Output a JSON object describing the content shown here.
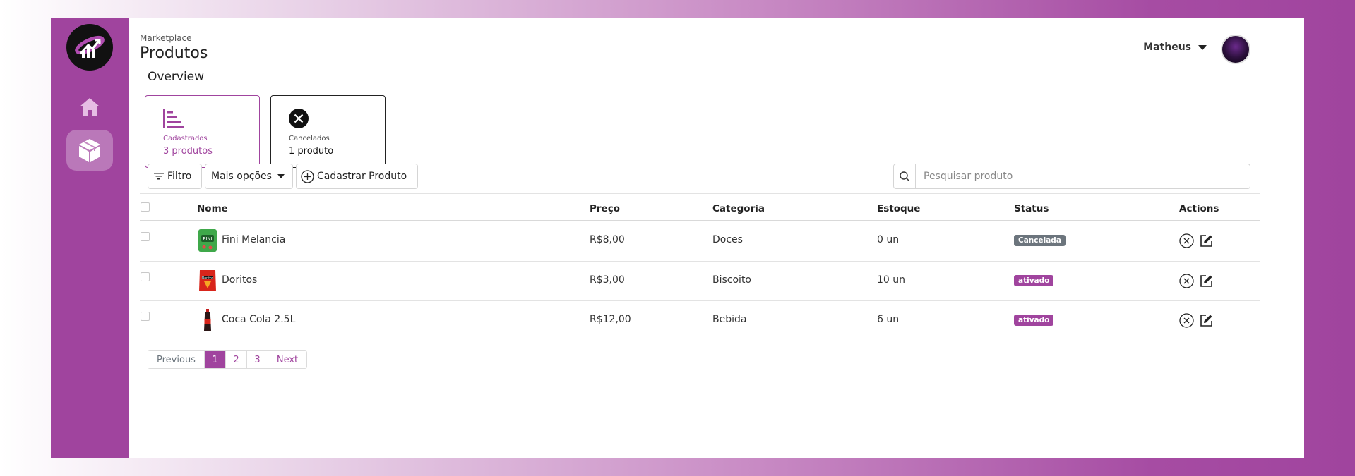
{
  "header": {
    "breadcrumb": "Marketplace",
    "title": "Produtos",
    "user_name": "Matheus"
  },
  "overview": {
    "title": "Overview",
    "cards": [
      {
        "label": "Cadastrados",
        "value": "3 produtos"
      },
      {
        "label": "Cancelados",
        "value": "1 produto"
      }
    ]
  },
  "toolbar": {
    "filter_label": "Filtro",
    "more_label": "Mais opções",
    "add_label": "Cadastrar Produto",
    "search_placeholder": "Pesquisar produto"
  },
  "table": {
    "columns": [
      "Nome",
      "Preço",
      "Categoria",
      "Estoque",
      "Status",
      "Actions"
    ],
    "rows": [
      {
        "name": "Fini Melancia",
        "price": "R$8,00",
        "category": "Doces",
        "stock": "0 un",
        "status": "Cancelada",
        "status_type": "canceled"
      },
      {
        "name": "Doritos",
        "price": "R$3,00",
        "category": "Biscoito",
        "stock": "10 un",
        "status": "ativado",
        "status_type": "active"
      },
      {
        "name": "Coca Cola 2.5L",
        "price": "R$12,00",
        "category": "Bebida",
        "stock": "6 un",
        "status": "ativado",
        "status_type": "active"
      }
    ]
  },
  "pagination": {
    "previous": "Previous",
    "pages": [
      "1",
      "2",
      "3"
    ],
    "current": "1",
    "next": "Next"
  },
  "colors": {
    "brand": "#a0449e",
    "canceled_badge": "#6c757d"
  },
  "icons": [
    "app-logo-icon",
    "home-icon",
    "box-icon",
    "list-icon",
    "cancel-circle-icon",
    "filter-icon",
    "plus-circle-icon",
    "search-icon",
    "x-circle-icon",
    "edit-icon"
  ]
}
